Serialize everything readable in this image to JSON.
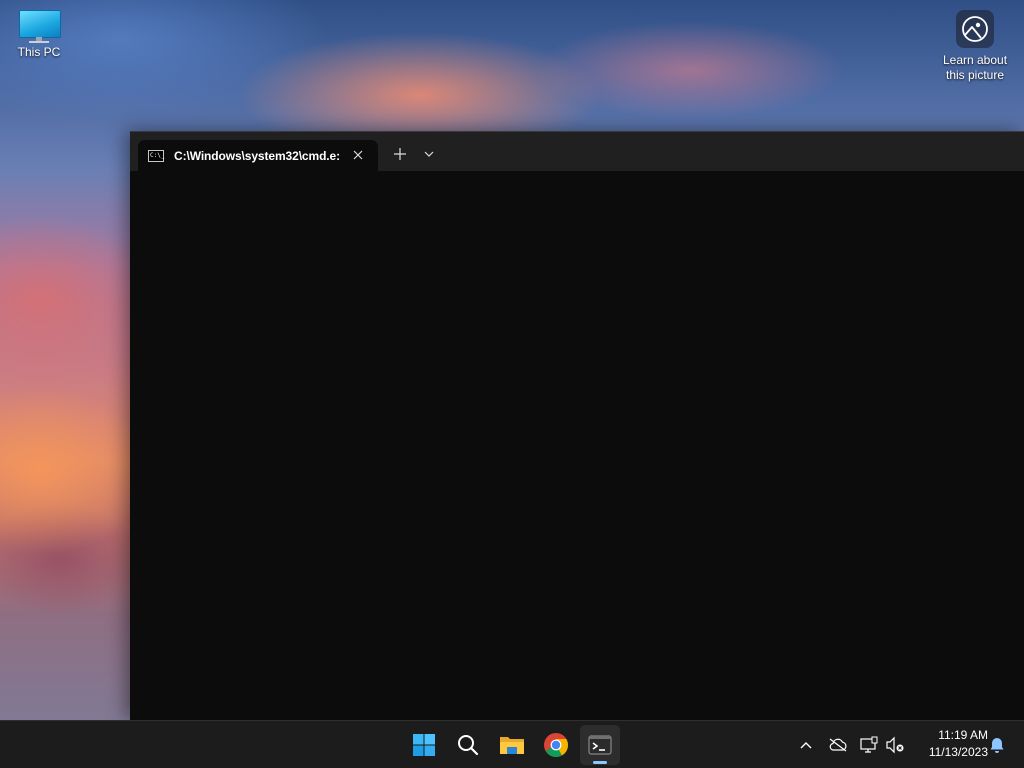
{
  "desktop": {
    "icons": [
      {
        "label": "This PC",
        "icon": "monitor-icon"
      },
      {
        "label": "Learn about\nthis picture",
        "line1": "Learn about",
        "line2": "this picture",
        "icon": "camera-icon"
      }
    ]
  },
  "terminal": {
    "tabs": [
      {
        "title": "C:\\Windows\\system32\\cmd.e:",
        "icon": "cmd-icon",
        "icon_text": "C:\\_"
      }
    ],
    "new_tab_icon": "plus-icon",
    "dropdown_icon": "chevron-down-icon",
    "console_bg": "#0c0c0c"
  },
  "taskbar": {
    "apps": [
      {
        "name": "Start",
        "icon": "windows-start-icon"
      },
      {
        "name": "Search",
        "icon": "search-icon"
      },
      {
        "name": "File Explorer",
        "icon": "folder-icon"
      },
      {
        "name": "Google Chrome",
        "icon": "chrome-icon"
      },
      {
        "name": "Terminal",
        "icon": "terminal-icon",
        "active": true
      }
    ],
    "tray": {
      "icons": [
        "chevron-up-icon",
        "cloud-off-icon",
        "network-icon",
        "volume-muted-icon"
      ]
    },
    "clock": {
      "time": "11:19 AM",
      "date": "11/13/2023"
    },
    "notification_icon": "bell-icon",
    "accent": "#8ec5ff"
  }
}
